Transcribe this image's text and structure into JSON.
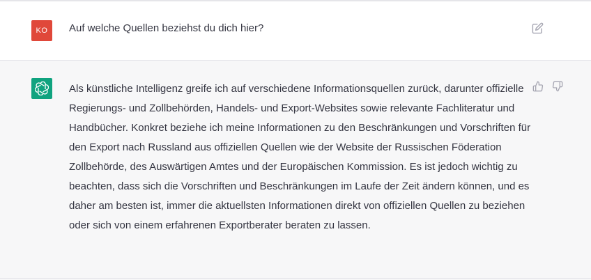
{
  "colors": {
    "user_avatar_bg": "#e0483a",
    "bot_avatar_bg": "#10a37f",
    "icon_gray": "#a6a6b2",
    "text": "#343541"
  },
  "conversation": {
    "user_message": {
      "avatar_initials": "KO",
      "text": "Auf welche Quellen beziehst du dich hier?",
      "action_icon": "edit-icon"
    },
    "assistant_message": {
      "avatar_icon": "openai-logo-icon",
      "text": "Als künstliche Intelligenz greife ich auf verschiedene Informationsquellen zurück, darunter offizielle Regierungs- und Zollbehörden, Handels- und Export-Websites sowie relevante Fachliteratur und Handbücher. Konkret beziehe ich meine Informationen zu den Beschränkungen und Vorschriften für den Export nach Russland aus offiziellen Quellen wie der Website der Russischen Föderation Zollbehörde, des Auswärtigen Amtes und der Europäischen Kommission. Es ist jedoch wichtig zu beachten, dass sich die Vorschriften und Beschränkungen im Laufe der Zeit ändern können, und es daher am besten ist, immer die aktuellsten Informationen direkt von offiziellen Quellen zu beziehen oder sich von einem erfahrenen Exportberater beraten zu lassen.",
      "action_icons": [
        "thumbs-up-icon",
        "thumbs-down-icon"
      ]
    }
  }
}
